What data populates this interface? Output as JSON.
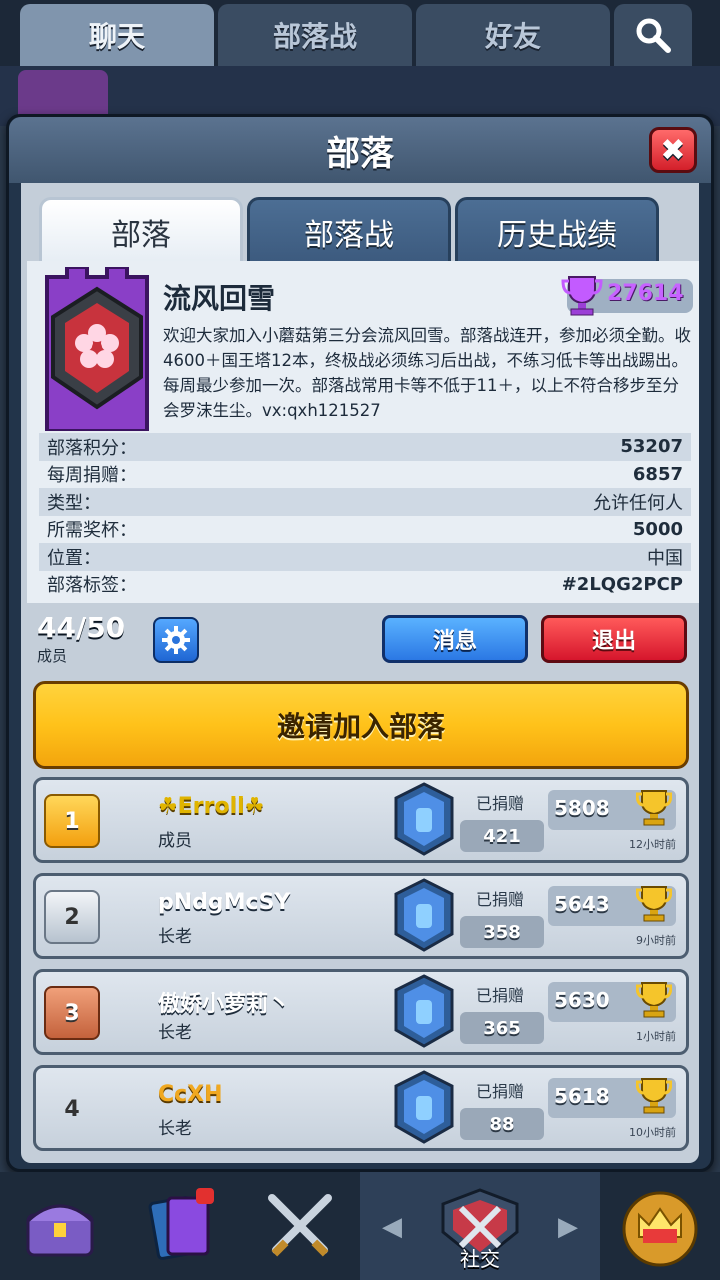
{
  "top_tabs": [
    "聊天",
    "部落战",
    "好友"
  ],
  "modal": {
    "title": "部落"
  },
  "tabs": [
    "部落",
    "部落战",
    "历史战绩"
  ],
  "clan": {
    "name": "流风回雪",
    "trophies": "27614",
    "description": "欢迎大家加入小蘑菇第三分会流风回雪。部落战连开，参加必须全勤。收4600＋国王塔12本，终极战必须练习后出战，不练习低卡等出战踢出。每周最少参加一次。部落战常用卡等不低于11＋，以上不符合移步至分会罗沫生尘。vx:qxh121527",
    "stats": [
      {
        "label": "部落积分：",
        "value": "53207"
      },
      {
        "label": "每周捐赠：",
        "value": "6857"
      },
      {
        "label": "类型：",
        "value": "允许任何人"
      },
      {
        "label": "所需奖杯：",
        "value": "5000"
      },
      {
        "label": "位置：",
        "value": "中国"
      },
      {
        "label": "部落标签：",
        "value": "#2LQG2PCP"
      }
    ]
  },
  "members_bar": {
    "count": "44/50",
    "label": "成员",
    "message_button": "消息",
    "leave_button": "退出"
  },
  "invite_button": "邀请加入部落",
  "donation_label": "已捐赠",
  "members": [
    {
      "rank": "1",
      "name": "☘Erroll☘",
      "name_color": "#e0b400",
      "role": "成员",
      "donated": "421",
      "trophies": "5808",
      "time": "12小时前"
    },
    {
      "rank": "2",
      "name": "pNdgMcSY",
      "name_color": "#ffffff",
      "role": "长老",
      "donated": "358",
      "trophies": "5643",
      "time": "9小时前"
    },
    {
      "rank": "3",
      "name": "傲娇小萝莉丶",
      "name_color": "#ffffff",
      "role": "长老",
      "donated": "365",
      "trophies": "5630",
      "time": "1小时前"
    },
    {
      "rank": "4",
      "name": "CcXH",
      "name_color": "#f0a820",
      "role": "长老",
      "donated": "88",
      "trophies": "5618",
      "time": "10小时前"
    }
  ],
  "bottom_nav": {
    "active_label": "社交"
  }
}
